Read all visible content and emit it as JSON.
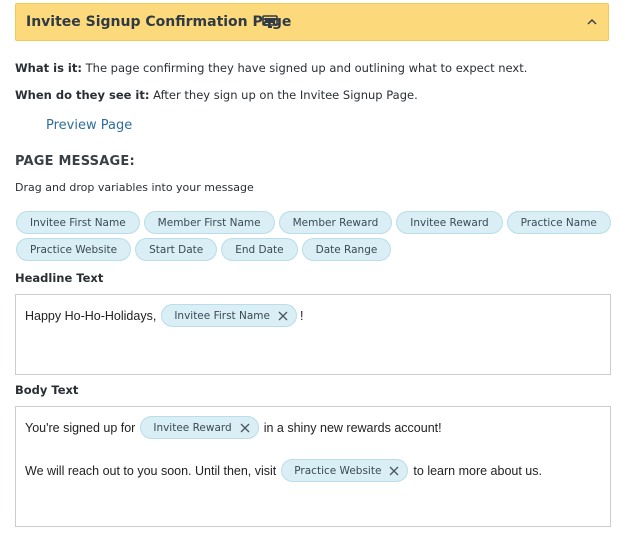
{
  "header": {
    "title": "Invitee Signup Confirmation Page",
    "icon": "monitor-icon",
    "toggle_icon": "chevron-up-icon",
    "background": "#fcd97a"
  },
  "info": {
    "what_label": "What is it:",
    "what_text": " The page confirming they have signed up and outlining what to expect next.",
    "when_label": "When do they see it:",
    "when_text": " After they sign up on the Invitee Signup Page."
  },
  "preview_link": "Preview Page",
  "page_message": {
    "title": "PAGE MESSAGE:",
    "helper": "Drag and drop variables into your message",
    "variables_row1": [
      "Invitee First Name",
      "Member First Name",
      "Member Reward",
      "Invitee Reward",
      "Practice Name"
    ],
    "variables_row2": [
      "Practice Website",
      "Start Date",
      "End Date",
      "Date Range"
    ]
  },
  "headline": {
    "label": "Headline Text",
    "before": "Happy Ho-Ho-Holidays,",
    "token": "Invitee First Name",
    "after": "!"
  },
  "body": {
    "label": "Body Text",
    "line1_before": "You're signed up for",
    "line1_token": "Invitee Reward",
    "line1_after": "in a shiny new rewards account!",
    "line2_before": "We will reach out to you soon. Until then, visit",
    "line2_token": "Practice Website",
    "line2_after": "to learn more about us."
  },
  "colors": {
    "chip_bg": "#d9eef5",
    "link": "#2e6f9b"
  }
}
